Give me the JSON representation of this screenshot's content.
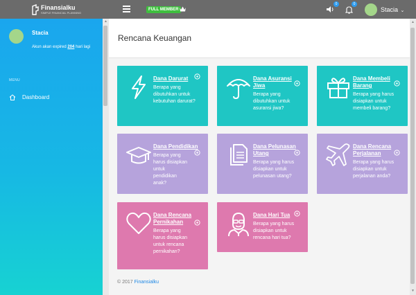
{
  "topbar": {
    "brand": "Finansialku",
    "brand_sub": "SIMPLE FINANCIAL PLANNING",
    "member_badge": "FULL MEMBER",
    "speaker_count": "0",
    "bell_count": "0",
    "username": "Stacia",
    "user_caret": "⌄"
  },
  "sidebar": {
    "name": "Stacia",
    "expire_prefix": "Akun akan expired",
    "expire_days": "204",
    "expire_suffix": "hari lagi",
    "section_label": "MENU",
    "menu": [
      {
        "label": "Dashboard",
        "icon": "home-icon"
      }
    ]
  },
  "main": {
    "title": "Rencana Keuangan",
    "cards": [
      {
        "id": "dana-darurat",
        "color": "teal",
        "icon": "lightning-icon",
        "title": "Dana Darurat",
        "desc": "Berapa yang dibutuhkan untuk kebutuhan darurat?"
      },
      {
        "id": "dana-asuransi-jiwa",
        "color": "teal",
        "icon": "umbrella-icon",
        "title": "Dana Asuransi Jiwa",
        "desc": "Berapa yang dibutuhkan untuk asuransi jiwa?"
      },
      {
        "id": "dana-membeli-barang",
        "color": "teal",
        "icon": "gift-icon",
        "title": "Dana Membeli Barang",
        "desc": "Berapa yang harus disiapkan untuk membeli barang?"
      },
      {
        "id": "dana-pendidikan",
        "color": "purple",
        "icon": "graduation-cap-icon",
        "title": "Dana Pendidikan",
        "desc": "Berapa yang harus disiapkan untuk pendidikan anak?"
      },
      {
        "id": "dana-pelunasan-utang",
        "color": "purple",
        "icon": "documents-icon",
        "title": "Dana Pelunasan Utang",
        "desc": "Berapa yang harus disiapkan untuk pelunasan utang?"
      },
      {
        "id": "dana-rencana-perjalanan",
        "color": "purple",
        "icon": "airplane-icon",
        "title": "Dana Rencana Perjalanan",
        "desc": "Berapa yang harus disiapkan untuk perjalanan anda?"
      },
      {
        "id": "dana-rencana-pernikahan",
        "color": "pink",
        "icon": "heart-icon",
        "title": "Dana Rencana Pernikahan",
        "desc": "Berapa yang harus disiapkan untuk rencana pernikahan?"
      },
      {
        "id": "dana-hari-tua",
        "color": "pink",
        "icon": "old-man-icon",
        "title": "Dana Hari Tua",
        "desc": "Berapa yang harus disiapkan untuk rencana hari tua?"
      }
    ]
  },
  "footer": {
    "copyright": "© 2017",
    "brand_link": "Finansialku"
  },
  "colors": {
    "teal": "#1fc6c4",
    "purple": "#b6a3dc",
    "pink": "#de79ae",
    "topbar": "#6b6b6b",
    "sidebar_top": "#1aa6ee",
    "sidebar_bottom": "#17d2d2"
  }
}
